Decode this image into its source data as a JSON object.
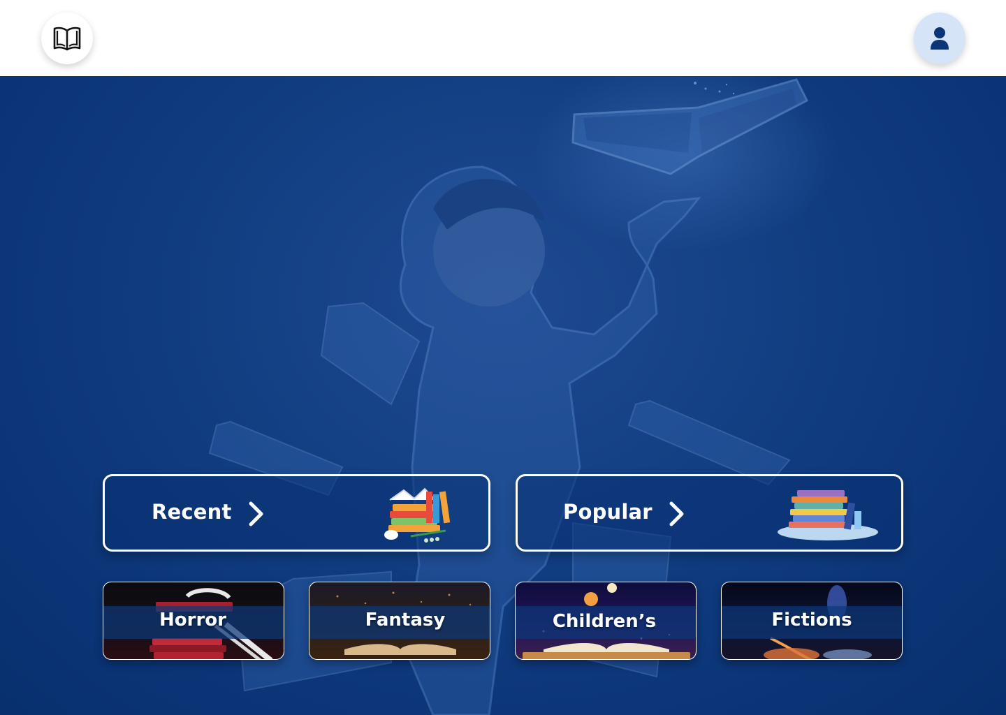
{
  "header": {
    "logo_icon": "open-book-icon",
    "profile_icon": "user-icon",
    "profile_bg": "#d5e4f7",
    "profile_icon_color": "#0b3577"
  },
  "hero": {
    "background_color": "#0b3577",
    "illustration": "girl-with-floating-books"
  },
  "featured": [
    {
      "label": "Recent",
      "icon": "chevron-right-icon",
      "art": "book-stack-with-cup"
    },
    {
      "label": "Popular",
      "icon": "chevron-right-icon",
      "art": "book-stack-colorful"
    }
  ],
  "genres": [
    {
      "label": "Horror"
    },
    {
      "label": "Fantasy"
    },
    {
      "label": "Children’s"
    },
    {
      "label": "Fictions"
    }
  ]
}
